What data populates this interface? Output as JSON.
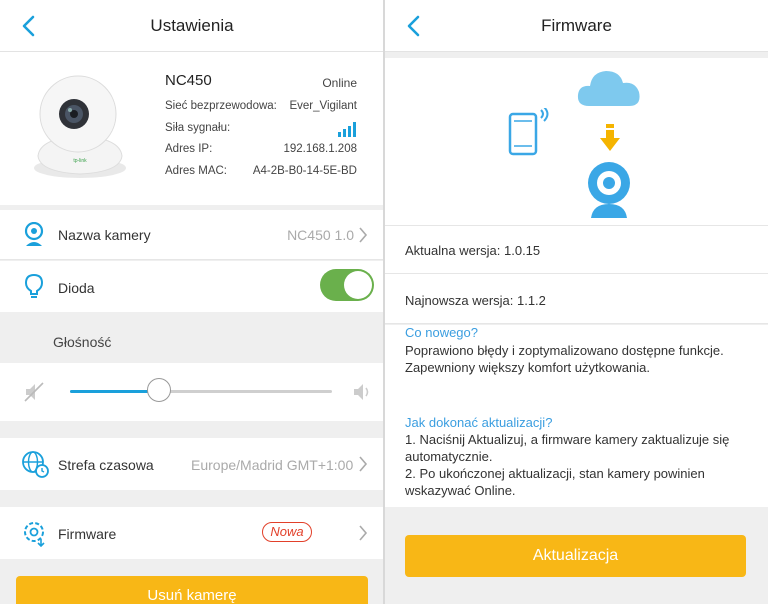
{
  "left": {
    "title": "Ustawienia",
    "camera": {
      "model": "NC450",
      "status": "Online",
      "brand_mark": "tp-link",
      "info": [
        {
          "key": "Sieć bezprzewodowa:",
          "value": "Ever_Vigilant"
        },
        {
          "key": "Siła sygnału:",
          "value": ""
        },
        {
          "key": "Adres IP:",
          "value": "192.168.1.208"
        },
        {
          "key": "Adres MAC:",
          "value": "A4-2B-B0-14-5E-BD"
        }
      ]
    },
    "camera_name": {
      "label": "Nazwa kamery",
      "value": "NC450 1.0"
    },
    "led": {
      "label": "Dioda",
      "enabled": true
    },
    "volume": {
      "label": "Głośność",
      "level": 0.34
    },
    "timezone": {
      "label": "Strefa czasowa",
      "value": "Europe/Madrid GMT+1:00"
    },
    "firmware": {
      "label": "Firmware",
      "badge": "Nowa"
    },
    "remove_button": "Usuń kamerę"
  },
  "right": {
    "title": "Firmware",
    "current_version": "Aktualna wersja: 1.0.15",
    "latest_version": "Najnowsza  wersja: 1.1.2",
    "whats_new_title": "Co nowego?",
    "whats_new_text": "Poprawiono błędy i zoptymalizowano dostępne funkcje. Zapewniony większy komfort użytkowania.",
    "howto_title": "Jak dokonać aktualizacji?",
    "howto_step1": "1. Naciśnij Aktualizuj, a firmware kamery zaktualizuje się automatycznie.",
    "howto_step2": "2. Po ukończonej aktualizacji, stan kamery powinien wskazywać Online.",
    "update_button": "Aktualizacja"
  },
  "colors": {
    "accent_blue": "#1aa0db",
    "toggle_green": "#6ab04c",
    "button_yellow": "#f8b716",
    "badge_red": "#e2402a",
    "cloud_blue": "#7ec9ee",
    "arrow_yellow": "#f5b400"
  },
  "icons": [
    "back-icon",
    "camera-icon",
    "bulb-icon",
    "mute-icon",
    "speaker-icon",
    "globe-clock-icon",
    "gear-icon",
    "chevron-right-icon",
    "phone-icon",
    "cloud-icon",
    "download-arrow-icon",
    "signal-icon"
  ]
}
